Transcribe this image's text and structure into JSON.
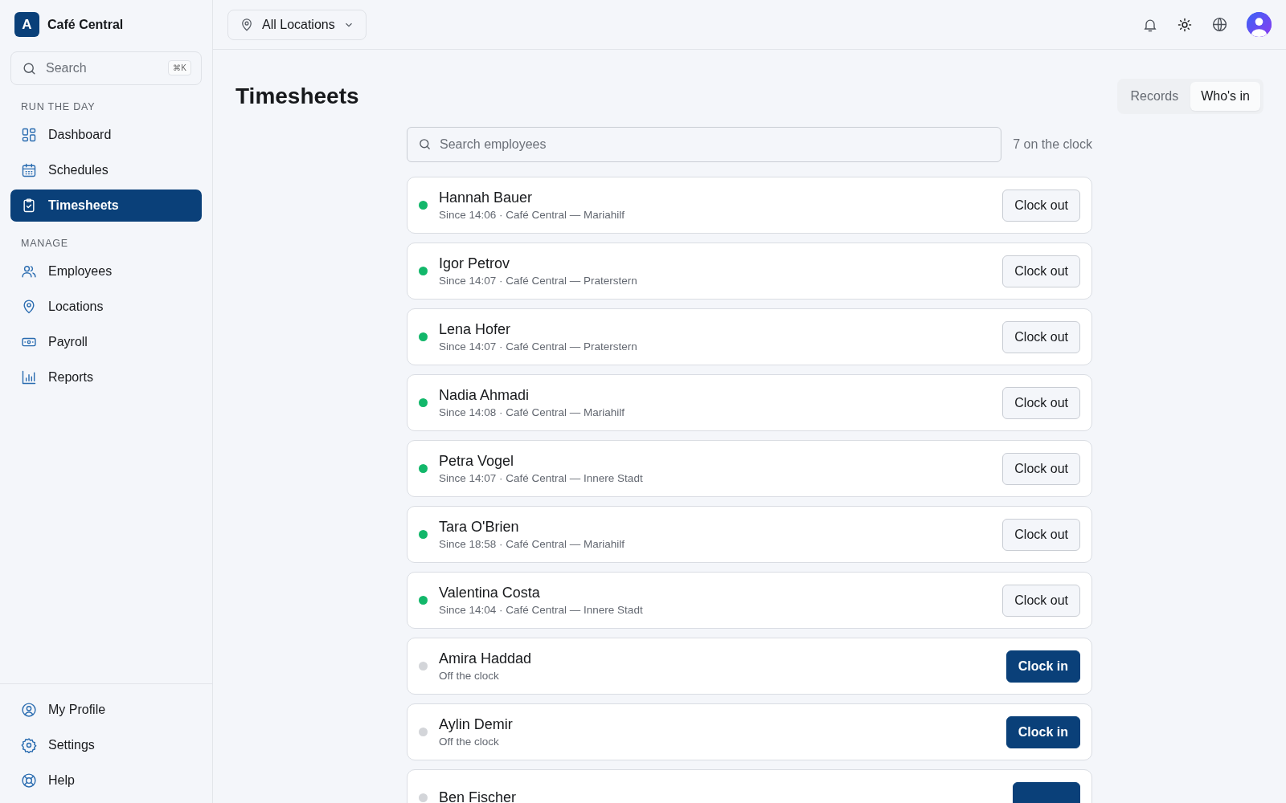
{
  "brand": {
    "logo": "A",
    "name": "Café Central"
  },
  "sidebar": {
    "search": {
      "placeholder": "Search",
      "shortcut": "⌘K"
    },
    "sections": [
      {
        "heading": "RUN THE DAY",
        "items": [
          {
            "label": "Dashboard",
            "selected": false
          },
          {
            "label": "Schedules",
            "selected": false
          },
          {
            "label": "Timesheets",
            "selected": true
          }
        ]
      },
      {
        "heading": "MANAGE",
        "items": [
          {
            "label": "Employees",
            "selected": false
          },
          {
            "label": "Locations",
            "selected": false
          },
          {
            "label": "Payroll",
            "selected": false
          },
          {
            "label": "Reports",
            "selected": false
          }
        ]
      }
    ],
    "footer_items": [
      {
        "label": "My Profile",
        "selected": false
      },
      {
        "label": "Settings",
        "selected": false
      },
      {
        "label": "Help",
        "selected": false
      }
    ]
  },
  "topbar": {
    "location": "All Locations"
  },
  "page": {
    "title": "Timesheets",
    "tabs": [
      {
        "label": "Records",
        "selected": false
      },
      {
        "label": "Who's in",
        "selected": true
      }
    ],
    "search": {
      "placeholder": "Search employees"
    },
    "count": "7 on the clock",
    "employees": [
      {
        "name": "Hannah Bauer",
        "detail": "Since 14:06 · Café Central — Mariahilf",
        "on_clock": true,
        "action": "Clock out"
      },
      {
        "name": "Igor Petrov",
        "detail": "Since 14:07 · Café Central — Praterstern",
        "on_clock": true,
        "action": "Clock out"
      },
      {
        "name": "Lena Hofer",
        "detail": "Since 14:07 · Café Central — Praterstern",
        "on_clock": true,
        "action": "Clock out"
      },
      {
        "name": "Nadia Ahmadi",
        "detail": "Since 14:08 · Café Central — Mariahilf",
        "on_clock": true,
        "action": "Clock out"
      },
      {
        "name": "Petra Vogel",
        "detail": "Since 14:07 · Café Central — Innere Stadt",
        "on_clock": true,
        "action": "Clock out"
      },
      {
        "name": "Tara O'Brien",
        "detail": "Since 18:58 · Café Central — Mariahilf",
        "on_clock": true,
        "action": "Clock out"
      },
      {
        "name": "Valentina Costa",
        "detail": "Since 14:04 · Café Central — Innere Stadt",
        "on_clock": true,
        "action": "Clock out"
      },
      {
        "name": "Amira Haddad",
        "detail": "Off the clock",
        "on_clock": false,
        "action": "Clock in"
      },
      {
        "name": "Aylin Demir",
        "detail": "Off the clock",
        "on_clock": false,
        "action": "Clock in"
      },
      {
        "name": "Ben Fischer",
        "on_clock": false
      }
    ]
  }
}
